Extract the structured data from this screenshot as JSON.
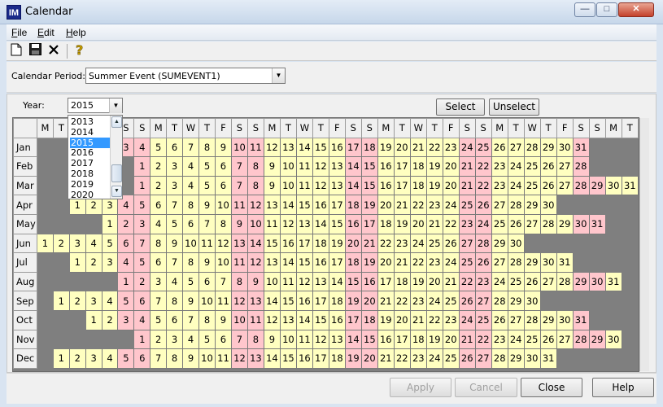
{
  "window": {
    "title": "Calendar",
    "app_icon_text": "IM",
    "minimize": "—",
    "maximize": "□",
    "close": "✕"
  },
  "menu": {
    "file": "File",
    "edit": "Edit",
    "help": "Help"
  },
  "toolbar": {
    "new_icon": "new-document-icon",
    "save_icon": "save-icon",
    "delete_icon": "delete-icon",
    "help_icon": "help-icon"
  },
  "period": {
    "label": "Calendar Period:",
    "value": "Summer Event (SUMEVENT1)"
  },
  "year": {
    "label": "Year:",
    "value": "2015",
    "options": [
      "2013",
      "2014",
      "2015",
      "2016",
      "2017",
      "2018",
      "2019",
      "2020"
    ],
    "selected_index": 2
  },
  "buttons": {
    "select": "Select",
    "unselect": "Unselect",
    "apply": "Apply",
    "cancel": "Cancel",
    "close": "Close",
    "help": "Help"
  },
  "calendar": {
    "day_headers": [
      "M",
      "T",
      "W",
      "T",
      "F",
      "S",
      "S",
      "M",
      "T",
      "W",
      "T",
      "F",
      "S",
      "S",
      "M",
      "T",
      "W",
      "T",
      "F",
      "S",
      "S",
      "M",
      "T",
      "W",
      "T",
      "F",
      "S",
      "S",
      "M",
      "T",
      "W",
      "T",
      "F",
      "S",
      "S",
      "M",
      "T"
    ],
    "months": [
      {
        "name": "Jan",
        "offset": 3,
        "days": 31
      },
      {
        "name": "Feb",
        "offset": 6,
        "days": 28
      },
      {
        "name": "Mar",
        "offset": 6,
        "days": 31
      },
      {
        "name": "Apr",
        "offset": 2,
        "days": 30
      },
      {
        "name": "May",
        "offset": 4,
        "days": 31
      },
      {
        "name": "Jun",
        "offset": 0,
        "days": 30
      },
      {
        "name": "Jul",
        "offset": 2,
        "days": 31
      },
      {
        "name": "Aug",
        "offset": 5,
        "days": 31
      },
      {
        "name": "Sep",
        "offset": 1,
        "days": 30
      },
      {
        "name": "Oct",
        "offset": 3,
        "days": 31
      },
      {
        "name": "Nov",
        "offset": 6,
        "days": 30
      },
      {
        "name": "Dec",
        "offset": 1,
        "days": 31
      }
    ],
    "colors": {
      "weekday": "#ffffc0",
      "weekend": "#ffc6cc",
      "empty": "#7f7f7f"
    }
  }
}
